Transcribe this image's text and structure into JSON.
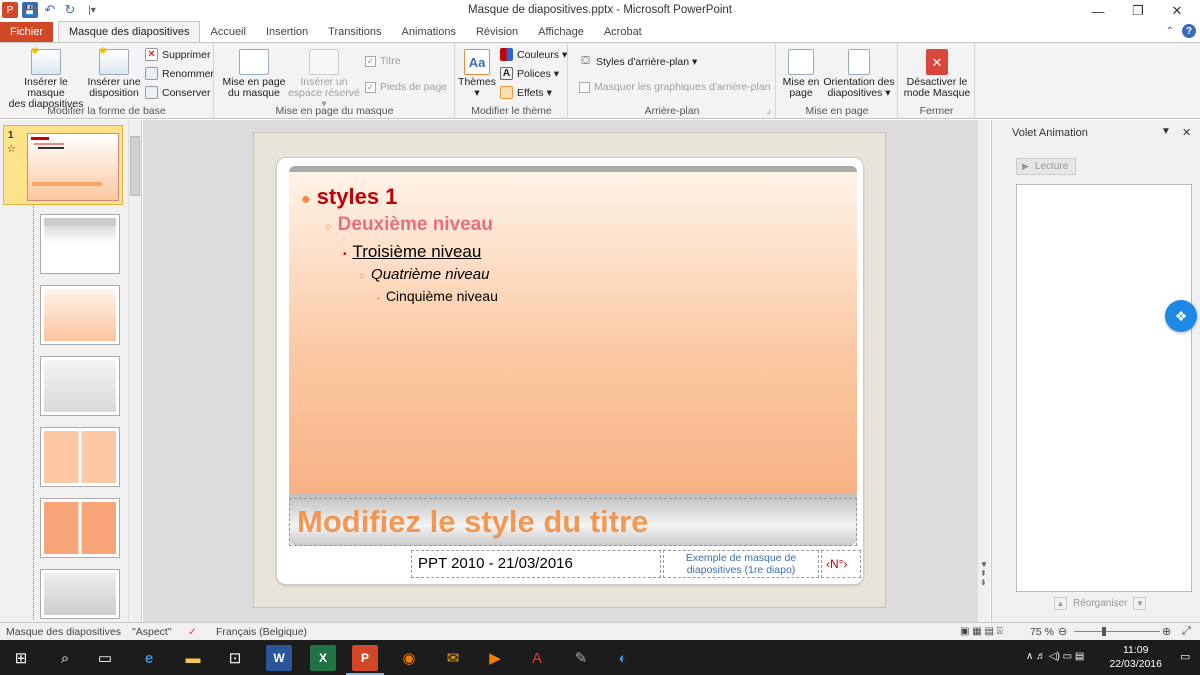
{
  "window": {
    "title": "Masque de diapositives.pptx - Microsoft PowerPoint",
    "minimize_icon": "—",
    "restore_icon": "❐",
    "close_icon": "✕"
  },
  "quick_access": {
    "app_icon": "P",
    "save_icon": "💾",
    "undo_icon": "↶",
    "redo_icon": "↻",
    "customize_icon": "|▾"
  },
  "tabs": [
    {
      "label": "Fichier"
    },
    {
      "label": "Masque des diapositives"
    },
    {
      "label": "Accueil"
    },
    {
      "label": "Insertion"
    },
    {
      "label": "Transitions"
    },
    {
      "label": "Animations"
    },
    {
      "label": "Révision"
    },
    {
      "label": "Affichage"
    },
    {
      "label": "Acrobat"
    }
  ],
  "ribbon": {
    "groups": {
      "base": "Modifier la forme de base",
      "layout": "Mise en page du masque",
      "theme": "Modifier le thème",
      "background": "Arrière-plan",
      "page": "Mise en page",
      "close": "Fermer"
    },
    "insert_master_1": "Insérer le masque",
    "insert_master_2": "des diapositives",
    "insert_layout_1": "Insérer une",
    "insert_layout_2": "disposition",
    "delete": "Supprimer",
    "rename": "Renommer",
    "preserve": "Conserver",
    "master_layout_1": "Mise en page",
    "master_layout_2": "du masque",
    "insert_placeholder_1": "Insérer un",
    "insert_placeholder_2": "espace réservé ▾",
    "title_check": "Titre",
    "footers_check": "Pieds de page",
    "themes_1": "Thèmes",
    "themes_2": "▾",
    "colors": "Couleurs ▾",
    "fonts": "Polices ▾",
    "effects": "Effets ▾",
    "background_styles": "Styles d'arrière-plan ▾",
    "hide_bg": "Masquer les graphiques d'arrière-plan",
    "page_setup_1": "Mise en",
    "page_setup_2": "page",
    "orientation_1": "Orientation des",
    "orientation_2": "diapositives ▾",
    "close_master_1": "Désactiver le",
    "close_master_2": "mode Masque",
    "dialog_launcher": "⌟"
  },
  "thumbs": {
    "slide_number": "1",
    "star": "☆"
  },
  "slide": {
    "level1": "styles 1",
    "level2": "Deuxième niveau",
    "level3": "Troisième niveau",
    "level4": "Quatrième niveau",
    "level5": "Cinquième niveau",
    "title": "Modifiez le style du titre",
    "footer_date": "PPT 2010  - 21/03/2016",
    "footer_text_1": "Exemple de masque de",
    "footer_text_2": "diapositives (1re diapo)",
    "page_number": "‹N°›",
    "colors": {
      "level1": "#c00000",
      "level2": "#e8707a",
      "accent": "#f28a3a"
    }
  },
  "anim_pane": {
    "title": "Volet Animation",
    "play": "Lecture",
    "play_icon": "▶",
    "reorder": "Réorganiser",
    "dropdown_icon": "▼",
    "close_icon": "✕"
  },
  "statusbar": {
    "view": "Masque des diapositives",
    "theme": "\"Aspect\"",
    "language": "Français (Belgique)",
    "zoom": "75 %"
  },
  "taskbar": {
    "time": "11:09",
    "date": "22/03/2016"
  }
}
